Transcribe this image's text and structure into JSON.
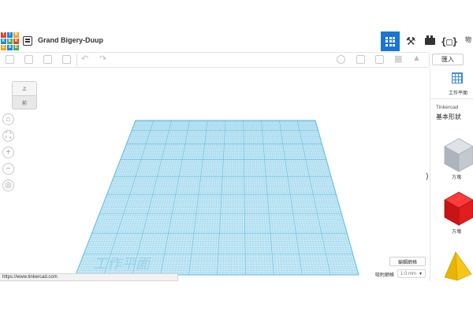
{
  "logo": {
    "letters": [
      "T",
      "I",
      "N",
      "K",
      "E",
      "R",
      "C",
      "A",
      "D"
    ]
  },
  "header": {
    "project_title": "Grand Bigery-Duup",
    "more_label": "物"
  },
  "toolbar": {
    "import_label": "匯入"
  },
  "viewcube": {
    "top_label": "上",
    "front_label": "前"
  },
  "nav": {
    "home": "⌂",
    "fit": "⛶",
    "zoom_in": "+",
    "zoom_out": "−",
    "ortho": "◎"
  },
  "workplane": {
    "watermark": "工作平面",
    "edit_grid_label": "編輯網格",
    "snap_label": "吸附網格",
    "snap_value": "1.0 mm"
  },
  "status": {
    "url": "https://www.tinkercad.com"
  },
  "panel": {
    "workplane_label": "工作平面",
    "library_name": "Tinkercad",
    "category": "基本形狀",
    "shapes": [
      {
        "label": "方塊",
        "color": "#b9bfc8"
      },
      {
        "label": "方塊",
        "color": "#e01e1e"
      },
      {
        "label": "",
        "color": "#f5c518"
      }
    ]
  },
  "colors": {
    "accent": "#1976d2",
    "grid": "#58b9de",
    "grid_fill": "#cbeaf6"
  }
}
